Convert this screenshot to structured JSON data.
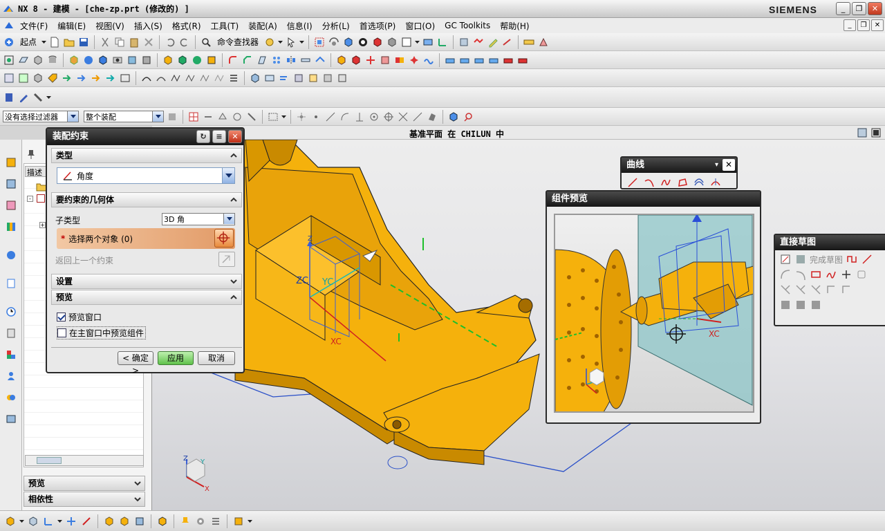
{
  "window": {
    "title": "NX 8 - 建模 - [che-zp.prt  (修改的) ]",
    "brand": "SIEMENS",
    "controls": [
      "_",
      "❐",
      "✕"
    ]
  },
  "menubar": {
    "items": [
      "文件(F)",
      "编辑(E)",
      "视图(V)",
      "插入(S)",
      "格式(R)",
      "工具(T)",
      "装配(A)",
      "信息(I)",
      "分析(L)",
      "首选项(P)",
      "窗口(O)",
      "GC Toolkits",
      "帮助(H)"
    ],
    "mdi_controls": [
      "_",
      "❐",
      "✕"
    ]
  },
  "toolbar1": {
    "start_label": "起点",
    "command_finder_label": "命令查找器"
  },
  "selection_bar": {
    "filter_value": "没有选择过滤器",
    "scope_value": "整个装配"
  },
  "status": {
    "text": "基准平面 在 CHILUN 中"
  },
  "nav": {
    "column_header": "描述",
    "sections": [
      "预览",
      "相依性"
    ]
  },
  "dialog": {
    "title": "装配约束",
    "type_header": "类型",
    "type_value": "角度",
    "geometry_header": "要约束的几何体",
    "subtype_label": "子类型",
    "subtype_value": "3D 角",
    "select_objects_label": "选择两个对象 (0)",
    "return_label": "返回上一个约束",
    "settings_header": "设置",
    "preview_header": "预览",
    "preview_window_label": "预览窗口",
    "preview_window_checked": true,
    "main_preview_label": "在主窗口中预览组件",
    "main_preview_checked": false,
    "ok_label": "< 确定 >",
    "apply_label": "应用",
    "cancel_label": "取消"
  },
  "curve_panel": {
    "title": "曲线"
  },
  "preview_panel": {
    "title": "组件预览",
    "axis_label": "XC"
  },
  "sketch_panel": {
    "title": "直接草图",
    "finish_label": "完成草图"
  },
  "viewport_labels": {
    "zc": "ZC",
    "yc": "YC",
    "xc": "XC",
    "z": "Z",
    "y": "Y",
    "x": "X"
  },
  "colors": {
    "part": "#f5b10c",
    "part_dark": "#c98a00",
    "dialog_title": "#1e1e1e",
    "selection_highlight": "#e6a070",
    "apply_button": "#7ad26a"
  }
}
